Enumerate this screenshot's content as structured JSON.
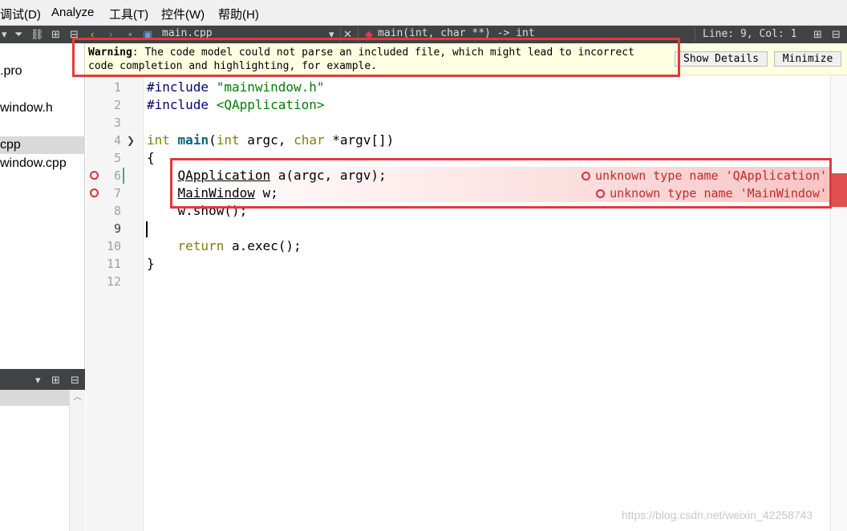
{
  "menu": [
    "调试(D)",
    "Analyze",
    "工具(T)",
    "控件(W)",
    "帮助(H)"
  ],
  "toolbar": {
    "file_name": "main.cpp",
    "symbol": "main(int, char **) -> int",
    "line_col": "Line: 9, Col: 1"
  },
  "sidebar": {
    "files": [
      ".pro",
      "window.h",
      "cpp",
      "window.cpp"
    ],
    "selected_index": 2
  },
  "warning": {
    "label": "Warning",
    "text_line1": ": The code model could not parse an included file, which might lead to incorrect",
    "text_line2": "code completion and highlighting, for example.",
    "show_details": "Show Details",
    "minimize": "Minimize"
  },
  "code": {
    "current_line": 9,
    "line_numbers": [
      "1",
      "2",
      "3",
      "4",
      "5",
      "6",
      "7",
      "8",
      "9",
      "10",
      "11",
      "12"
    ],
    "lines": [
      "#include \"mainwindow.h\"",
      "#include <QApplication>",
      "",
      "int main(int argc, char *argv[])",
      "{",
      "    QApplication a(argc, argv);",
      "    MainWindow w;",
      "    w.show();",
      "",
      "    return a.exec();",
      "}",
      ""
    ],
    "errors": [
      {
        "line": 6,
        "message": "unknown type name 'QApplication'"
      },
      {
        "line": 7,
        "message": "unknown type name 'MainWindow'"
      }
    ]
  },
  "watermark": "https://blog.csdn.net/weixin_42258743",
  "colors": {
    "error": "#e53935",
    "warning_bg": "#ffffe1",
    "toolbar_bg": "#414243"
  }
}
